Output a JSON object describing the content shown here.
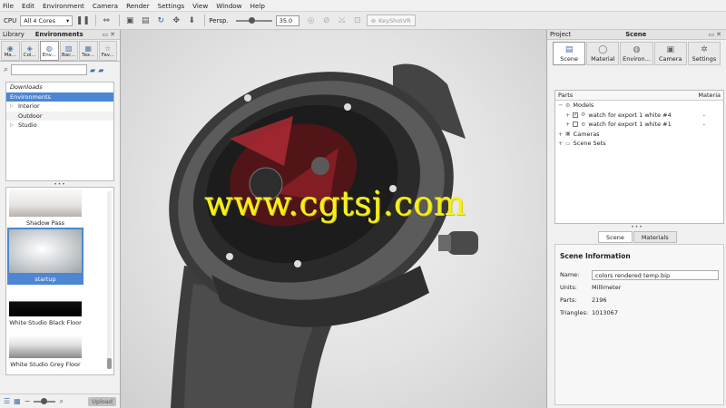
{
  "menu": [
    "File",
    "Edit",
    "Environment",
    "Camera",
    "Render",
    "Settings",
    "View",
    "Window",
    "Help"
  ],
  "toolbar": {
    "cpu_label": "CPU",
    "cores_value": "All 4 Cores",
    "persp_label": "Persp.",
    "persp_value": "35.0",
    "keyshotvr_label": "KeyShotVR"
  },
  "library": {
    "panel_label": "Library",
    "panel_title": "Environments",
    "tabs": [
      "Ma...",
      "Col...",
      "Env...",
      "Bac...",
      "Tex...",
      "Fav..."
    ],
    "tree": [
      "Downloads",
      "Environments",
      "Interior",
      "Outdoor",
      "Studio"
    ],
    "thumbnails": [
      "Shadow Pass",
      "startup",
      "White Studio Black Floor",
      "White Studio Grey Floor"
    ],
    "upload_label": "Upload"
  },
  "viewport": {
    "watermark": "www.cgtsj.com"
  },
  "project": {
    "panel_label": "Project",
    "panel_title": "Scene",
    "tabs": [
      "Scene",
      "Material",
      "Environ...",
      "Camera",
      "Settings"
    ],
    "parts_header": "Parts",
    "material_header": "Materia",
    "parts": {
      "models": "Models",
      "model1": "watch for export 1 white #4",
      "model1_val": "-",
      "model2": "watch for export 1 white #1",
      "model2_val": "-",
      "cameras": "Cameras",
      "scene_sets": "Scene Sets"
    },
    "sub_tabs": [
      "Scene",
      "Materials"
    ],
    "info": {
      "title": "Scene Information",
      "name_label": "Name:",
      "name_value": "colors rendered temp.bip",
      "units_label": "Units:",
      "units_value": "Millimeter",
      "parts_label": "Parts:",
      "parts_value": "2196",
      "triangles_label": "Triangles:",
      "triangles_value": "1013067"
    }
  }
}
